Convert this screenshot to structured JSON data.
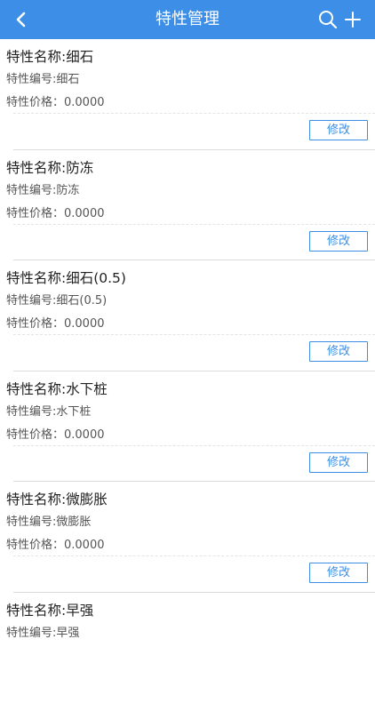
{
  "header": {
    "title": "特性管理",
    "back_icon": "chevron-left-icon",
    "search_icon": "search-icon",
    "add_icon": "plus-icon",
    "bg_color": "#3d8ee6"
  },
  "items": [
    {
      "name": "特性名称:细石",
      "code": "特性编号:细石",
      "price": "特性价格：0.0000",
      "edit_label": "修改"
    },
    {
      "name": "特性名称:防冻",
      "code": "特性编号:防冻",
      "price": "特性价格：0.0000",
      "edit_label": "修改"
    },
    {
      "name": "特性名称:细石(0.5)",
      "code": "特性编号:细石(0.5)",
      "price": "特性价格：0.0000",
      "edit_label": "修改"
    },
    {
      "name": "特性名称:水下桩",
      "code": "特性编号:水下桩",
      "price": "特性价格：0.0000",
      "edit_label": "修改"
    },
    {
      "name": "特性名称:微膨胀",
      "code": "特性编号:微膨胀",
      "price": "特性价格：0.0000",
      "edit_label": "修改"
    },
    {
      "name": "特性名称:早强",
      "code": "特性编号:早强"
    }
  ]
}
